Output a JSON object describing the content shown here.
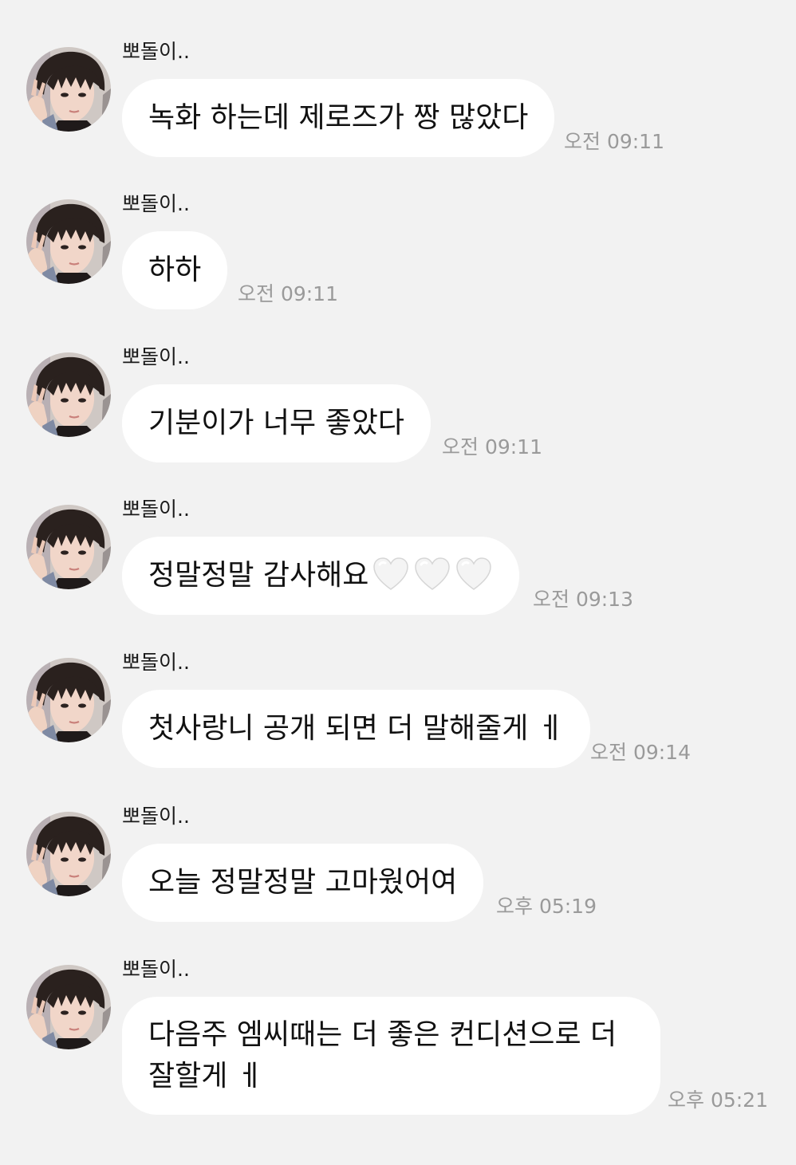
{
  "messages": [
    {
      "sender": "뽀돌이..",
      "text": "녹화 하는데 제로즈가 짱 많았다",
      "time": "오전 09:11"
    },
    {
      "sender": "뽀돌이..",
      "text": "하하",
      "time": "오전 09:11"
    },
    {
      "sender": "뽀돌이..",
      "text": "기분이가 너무 좋았다",
      "time": "오전 09:11"
    },
    {
      "sender": "뽀돌이..",
      "text": "정말정말 감사해요",
      "emoji": "🤍🤍🤍",
      "emoji_icon": "white-heart-icon",
      "time": "오전 09:13"
    },
    {
      "sender": "뽀돌이..",
      "text": "첫사랑니 공개 되면 더 말해줄게 ㅔ",
      "time": "오전 09:14"
    },
    {
      "sender": "뽀돌이..",
      "text": "오늘 정말정말 고마웠어여",
      "time": "오후 05:19"
    },
    {
      "sender": "뽀돌이..",
      "text_lines": [
        "다음주 엠씨때는 더 좋은 컨디션으로 더",
        "잘할게 ㅔ"
      ],
      "time": "오후 05:21"
    }
  ],
  "colors": {
    "background": "#f2f2f2",
    "bubble": "#ffffff",
    "timestamp": "#9a9a9a"
  }
}
